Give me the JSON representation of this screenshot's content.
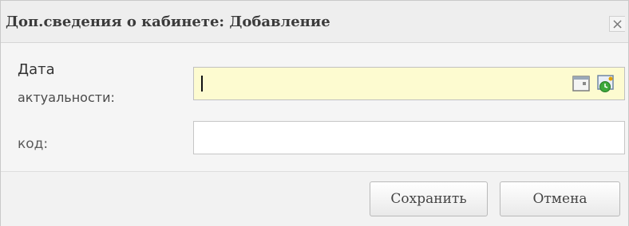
{
  "dialog": {
    "title": "Доп.сведения о кабинете: Добавление",
    "close_label": "×"
  },
  "form": {
    "date_label_line1": "Дата",
    "date_label_line2": "актуальности:",
    "date_value": "",
    "code_label": "код:",
    "code_value": ""
  },
  "footer": {
    "save_label": "Сохранить",
    "cancel_label": "Отмена"
  },
  "icons": {
    "date_picker": "calendar-icon",
    "time_picker": "clock-icon"
  },
  "colors": {
    "required_field_bg": "#fdfbd0",
    "dialog_bg": "#f2f2f2"
  }
}
